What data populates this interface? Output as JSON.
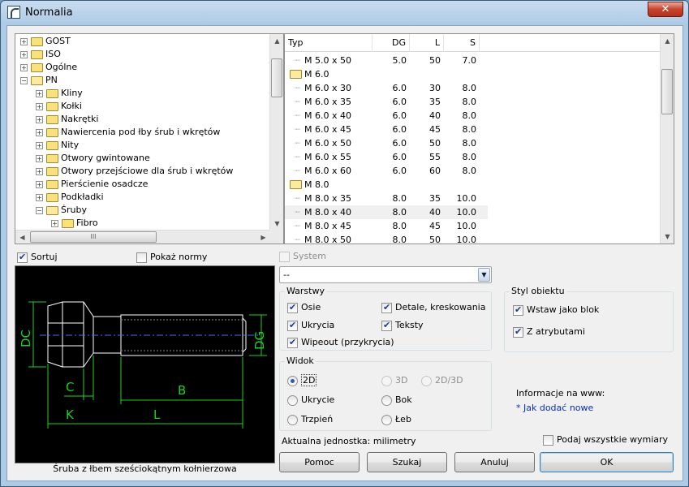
{
  "window": {
    "title": "Normalia",
    "close_glyph": "✕"
  },
  "tree": {
    "items": [
      {
        "label": "GOST",
        "level": 0,
        "expander": "+",
        "open": false
      },
      {
        "label": "ISO",
        "level": 0,
        "expander": "+",
        "open": false
      },
      {
        "label": "Ogólne",
        "level": 0,
        "expander": "+",
        "open": false
      },
      {
        "label": "PN",
        "level": 0,
        "expander": "−",
        "open": true
      },
      {
        "label": "Kliny",
        "level": 1,
        "expander": "+",
        "open": false
      },
      {
        "label": "Kołki",
        "level": 1,
        "expander": "+",
        "open": false
      },
      {
        "label": "Nakrętki",
        "level": 1,
        "expander": "+",
        "open": false
      },
      {
        "label": "Nawiercenia pod łby śrub i wkrętów",
        "level": 1,
        "expander": "+",
        "open": false
      },
      {
        "label": "Nity",
        "level": 1,
        "expander": "+",
        "open": false
      },
      {
        "label": "Otwory gwintowane",
        "level": 1,
        "expander": "+",
        "open": false
      },
      {
        "label": "Otwory przejściowe dla śrub i wkrętów",
        "level": 1,
        "expander": "+",
        "open": false
      },
      {
        "label": "Pierścienie osadcze",
        "level": 1,
        "expander": "+",
        "open": false
      },
      {
        "label": "Podkładki",
        "level": 1,
        "expander": "+",
        "open": false
      },
      {
        "label": "Śruby",
        "level": 1,
        "expander": "−",
        "open": true
      },
      {
        "label": "Fibro",
        "level": 2,
        "expander": "+",
        "open": false
      }
    ],
    "hscroll_thumb_glyph": "III"
  },
  "list": {
    "columns": [
      "Typ",
      "DG",
      "L",
      "S"
    ],
    "rows": [
      {
        "typ": "M 5.0 x 50",
        "dg": "5.0",
        "l": "50",
        "s": "7.0",
        "kind": "item"
      },
      {
        "typ": "M 6.0",
        "dg": "",
        "l": "",
        "s": "",
        "kind": "group"
      },
      {
        "typ": "M 6.0 x 30",
        "dg": "6.0",
        "l": "30",
        "s": "8.0",
        "kind": "item"
      },
      {
        "typ": "M 6.0 x 35",
        "dg": "6.0",
        "l": "35",
        "s": "8.0",
        "kind": "item"
      },
      {
        "typ": "M 6.0 x 40",
        "dg": "6.0",
        "l": "40",
        "s": "8.0",
        "kind": "item"
      },
      {
        "typ": "M 6.0 x 45",
        "dg": "6.0",
        "l": "45",
        "s": "8.0",
        "kind": "item"
      },
      {
        "typ": "M 6.0 x 50",
        "dg": "6.0",
        "l": "50",
        "s": "8.0",
        "kind": "item"
      },
      {
        "typ": "M 6.0 x 55",
        "dg": "6.0",
        "l": "55",
        "s": "8.0",
        "kind": "item"
      },
      {
        "typ": "M 6.0 x 60",
        "dg": "6.0",
        "l": "60",
        "s": "8.0",
        "kind": "item"
      },
      {
        "typ": "M 8.0",
        "dg": "",
        "l": "",
        "s": "",
        "kind": "group"
      },
      {
        "typ": "M 8.0 x 35",
        "dg": "8.0",
        "l": "35",
        "s": "10.0",
        "kind": "item"
      },
      {
        "typ": "M 8.0 x 40",
        "dg": "8.0",
        "l": "40",
        "s": "10.0",
        "kind": "item",
        "selected": true
      },
      {
        "typ": "M 8.0 x 45",
        "dg": "8.0",
        "l": "45",
        "s": "10.0",
        "kind": "item"
      },
      {
        "typ": "M 8.0 x 50",
        "dg": "8.0",
        "l": "50",
        "s": "10.0",
        "kind": "item"
      }
    ]
  },
  "options": {
    "sortuj": {
      "label": "Sortuj",
      "checked": true
    },
    "pokaz_normy": {
      "label": "Pokaż normy",
      "checked": false
    },
    "system": {
      "label": "System",
      "checked": false,
      "disabled": true
    },
    "system_combo_value": "--"
  },
  "preview": {
    "caption": "Śruba z łbem sześciokątnym kołnierzowa",
    "dims": {
      "dc": "DC",
      "dg": "DG",
      "b": "B",
      "c": "C",
      "k": "K",
      "l": "L"
    }
  },
  "warstwy": {
    "title": "Warstwy",
    "items": [
      {
        "label": "Osie",
        "checked": true
      },
      {
        "label": "Detale, kreskowania",
        "checked": true
      },
      {
        "label": "Ukrycia",
        "checked": true
      },
      {
        "label": "Teksty",
        "checked": true
      },
      {
        "label": "Wipeout (przykrycia)",
        "checked": true
      }
    ]
  },
  "styl": {
    "title": "Styl obiektu",
    "items": [
      {
        "label": "Wstaw jako blok",
        "checked": true
      },
      {
        "label": "Z atrybutami",
        "checked": true
      }
    ]
  },
  "widok": {
    "title": "Widok",
    "items": [
      {
        "label": "2D",
        "checked": true,
        "disabled": false
      },
      {
        "label": "3D",
        "checked": false,
        "disabled": true
      },
      {
        "label": "2D/3D",
        "checked": false,
        "disabled": true
      },
      {
        "label": "Ukrycie",
        "checked": false,
        "disabled": false
      },
      {
        "label": "Bok",
        "checked": false,
        "disabled": false
      },
      {
        "label": "Trzpień",
        "checked": false,
        "disabled": false
      },
      {
        "label": "Łeb",
        "checked": false,
        "disabled": false
      }
    ]
  },
  "info": {
    "label": "Informacje na www:",
    "link": "* Jak dodać nowe"
  },
  "unit_text": "Aktualna jednostka: milimetry",
  "podaj": {
    "label": "Podaj wszystkie wymiary",
    "checked": false
  },
  "buttons": {
    "pomoc": "Pomoc",
    "szukaj": "Szukaj",
    "anuluj": "Anuluj",
    "ok": "OK"
  }
}
